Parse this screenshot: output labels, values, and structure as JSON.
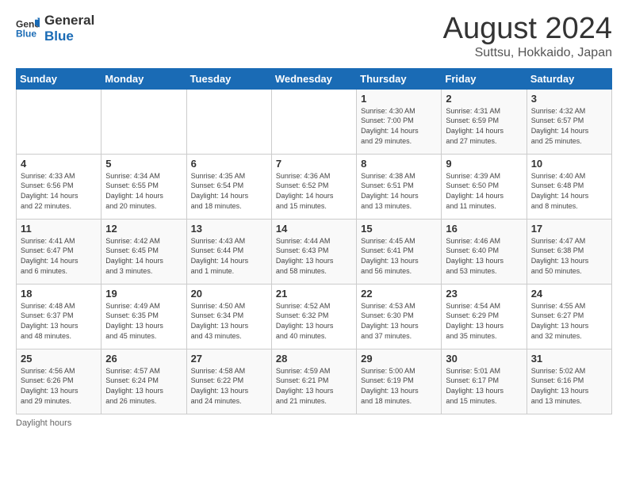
{
  "header": {
    "logo_line1": "General",
    "logo_line2": "Blue",
    "main_title": "August 2024",
    "subtitle": "Suttsu, Hokkaido, Japan"
  },
  "days_of_week": [
    "Sunday",
    "Monday",
    "Tuesday",
    "Wednesday",
    "Thursday",
    "Friday",
    "Saturday"
  ],
  "weeks": [
    [
      {
        "num": "",
        "info": ""
      },
      {
        "num": "",
        "info": ""
      },
      {
        "num": "",
        "info": ""
      },
      {
        "num": "",
        "info": ""
      },
      {
        "num": "1",
        "info": "Sunrise: 4:30 AM\nSunset: 7:00 PM\nDaylight: 14 hours\nand 29 minutes."
      },
      {
        "num": "2",
        "info": "Sunrise: 4:31 AM\nSunset: 6:59 PM\nDaylight: 14 hours\nand 27 minutes."
      },
      {
        "num": "3",
        "info": "Sunrise: 4:32 AM\nSunset: 6:57 PM\nDaylight: 14 hours\nand 25 minutes."
      }
    ],
    [
      {
        "num": "4",
        "info": "Sunrise: 4:33 AM\nSunset: 6:56 PM\nDaylight: 14 hours\nand 22 minutes."
      },
      {
        "num": "5",
        "info": "Sunrise: 4:34 AM\nSunset: 6:55 PM\nDaylight: 14 hours\nand 20 minutes."
      },
      {
        "num": "6",
        "info": "Sunrise: 4:35 AM\nSunset: 6:54 PM\nDaylight: 14 hours\nand 18 minutes."
      },
      {
        "num": "7",
        "info": "Sunrise: 4:36 AM\nSunset: 6:52 PM\nDaylight: 14 hours\nand 15 minutes."
      },
      {
        "num": "8",
        "info": "Sunrise: 4:38 AM\nSunset: 6:51 PM\nDaylight: 14 hours\nand 13 minutes."
      },
      {
        "num": "9",
        "info": "Sunrise: 4:39 AM\nSunset: 6:50 PM\nDaylight: 14 hours\nand 11 minutes."
      },
      {
        "num": "10",
        "info": "Sunrise: 4:40 AM\nSunset: 6:48 PM\nDaylight: 14 hours\nand 8 minutes."
      }
    ],
    [
      {
        "num": "11",
        "info": "Sunrise: 4:41 AM\nSunset: 6:47 PM\nDaylight: 14 hours\nand 6 minutes."
      },
      {
        "num": "12",
        "info": "Sunrise: 4:42 AM\nSunset: 6:45 PM\nDaylight: 14 hours\nand 3 minutes."
      },
      {
        "num": "13",
        "info": "Sunrise: 4:43 AM\nSunset: 6:44 PM\nDaylight: 14 hours\nand 1 minute."
      },
      {
        "num": "14",
        "info": "Sunrise: 4:44 AM\nSunset: 6:43 PM\nDaylight: 13 hours\nand 58 minutes."
      },
      {
        "num": "15",
        "info": "Sunrise: 4:45 AM\nSunset: 6:41 PM\nDaylight: 13 hours\nand 56 minutes."
      },
      {
        "num": "16",
        "info": "Sunrise: 4:46 AM\nSunset: 6:40 PM\nDaylight: 13 hours\nand 53 minutes."
      },
      {
        "num": "17",
        "info": "Sunrise: 4:47 AM\nSunset: 6:38 PM\nDaylight: 13 hours\nand 50 minutes."
      }
    ],
    [
      {
        "num": "18",
        "info": "Sunrise: 4:48 AM\nSunset: 6:37 PM\nDaylight: 13 hours\nand 48 minutes."
      },
      {
        "num": "19",
        "info": "Sunrise: 4:49 AM\nSunset: 6:35 PM\nDaylight: 13 hours\nand 45 minutes."
      },
      {
        "num": "20",
        "info": "Sunrise: 4:50 AM\nSunset: 6:34 PM\nDaylight: 13 hours\nand 43 minutes."
      },
      {
        "num": "21",
        "info": "Sunrise: 4:52 AM\nSunset: 6:32 PM\nDaylight: 13 hours\nand 40 minutes."
      },
      {
        "num": "22",
        "info": "Sunrise: 4:53 AM\nSunset: 6:30 PM\nDaylight: 13 hours\nand 37 minutes."
      },
      {
        "num": "23",
        "info": "Sunrise: 4:54 AM\nSunset: 6:29 PM\nDaylight: 13 hours\nand 35 minutes."
      },
      {
        "num": "24",
        "info": "Sunrise: 4:55 AM\nSunset: 6:27 PM\nDaylight: 13 hours\nand 32 minutes."
      }
    ],
    [
      {
        "num": "25",
        "info": "Sunrise: 4:56 AM\nSunset: 6:26 PM\nDaylight: 13 hours\nand 29 minutes."
      },
      {
        "num": "26",
        "info": "Sunrise: 4:57 AM\nSunset: 6:24 PM\nDaylight: 13 hours\nand 26 minutes."
      },
      {
        "num": "27",
        "info": "Sunrise: 4:58 AM\nSunset: 6:22 PM\nDaylight: 13 hours\nand 24 minutes."
      },
      {
        "num": "28",
        "info": "Sunrise: 4:59 AM\nSunset: 6:21 PM\nDaylight: 13 hours\nand 21 minutes."
      },
      {
        "num": "29",
        "info": "Sunrise: 5:00 AM\nSunset: 6:19 PM\nDaylight: 13 hours\nand 18 minutes."
      },
      {
        "num": "30",
        "info": "Sunrise: 5:01 AM\nSunset: 6:17 PM\nDaylight: 13 hours\nand 15 minutes."
      },
      {
        "num": "31",
        "info": "Sunrise: 5:02 AM\nSunset: 6:16 PM\nDaylight: 13 hours\nand 13 minutes."
      }
    ]
  ],
  "footer": {
    "text": "Daylight hours"
  },
  "colors": {
    "header_bg": "#1a6bb5",
    "header_text": "#ffffff",
    "brand_blue": "#1a6bb5"
  }
}
